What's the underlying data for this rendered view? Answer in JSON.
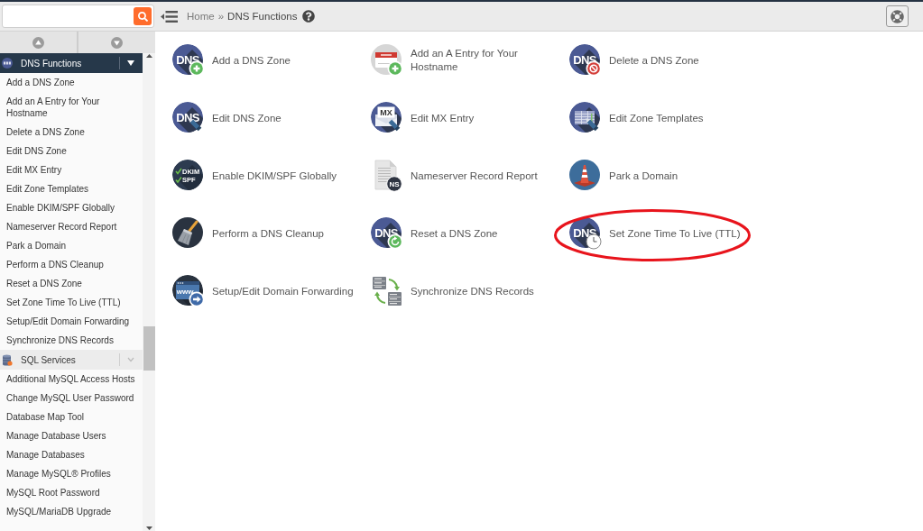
{
  "breadcrumb": {
    "separator": "»",
    "items": [
      {
        "label": "Home",
        "current": false
      },
      {
        "label": "DNS Functions",
        "current": true
      }
    ]
  },
  "sidebar": {
    "sections": [
      {
        "title": "DNS Functions",
        "selected": true,
        "items": [
          "Add a DNS Zone",
          "Add an A Entry for Your Hostname",
          "Delete a DNS Zone",
          "Edit DNS Zone",
          "Edit MX Entry",
          "Edit Zone Templates",
          "Enable DKIM/SPF Globally",
          "Nameserver Record Report",
          "Park a Domain",
          "Perform a DNS Cleanup",
          "Reset a DNS Zone",
          "Set Zone Time To Live (TTL)",
          "Setup/Edit Domain Forwarding",
          "Synchronize DNS Records"
        ]
      },
      {
        "title": "SQL Services",
        "selected": false,
        "items": [
          "Additional MySQL Access Hosts",
          "Change MySQL User Password",
          "Database Map Tool",
          "Manage Database Users",
          "Manage Databases",
          "Manage MySQL® Profiles",
          "MySQL Root Password",
          "MySQL/MariaDB Upgrade"
        ]
      }
    ]
  },
  "main": {
    "items": [
      {
        "label": "Add a DNS Zone",
        "icon_text": [
          "DNS"
        ],
        "highlighted": false
      },
      {
        "label": "Add an A Entry for Your Hostname",
        "highlighted": false
      },
      {
        "label": "Delete a DNS Zone",
        "icon_text": [
          "DNS"
        ],
        "highlighted": false
      },
      {
        "label": "Edit DNS Zone",
        "icon_text": [
          "DNS"
        ],
        "highlighted": false
      },
      {
        "label": "Edit MX Entry",
        "icon_text": [
          "MX"
        ],
        "highlighted": false
      },
      {
        "label": "Edit Zone Templates",
        "highlighted": false
      },
      {
        "label": "Enable DKIM/SPF Globally",
        "icon_text": [
          "DKIM",
          "SPF"
        ],
        "highlighted": false
      },
      {
        "label": "Nameserver Record Report",
        "icon_text": [
          "NS"
        ],
        "highlighted": false
      },
      {
        "label": "Park a Domain",
        "highlighted": false
      },
      {
        "label": "Perform a DNS Cleanup",
        "highlighted": false
      },
      {
        "label": "Reset a DNS Zone",
        "icon_text": [
          "DNS"
        ],
        "highlighted": false
      },
      {
        "label": "Set Zone Time To Live (TTL)",
        "icon_text": [
          "DNS"
        ],
        "highlighted": true
      },
      {
        "label": "Setup/Edit Domain Forwarding",
        "icon_text": [
          "www."
        ],
        "highlighted": false
      },
      {
        "label": "Synchronize DNS Records",
        "highlighted": false
      }
    ]
  }
}
